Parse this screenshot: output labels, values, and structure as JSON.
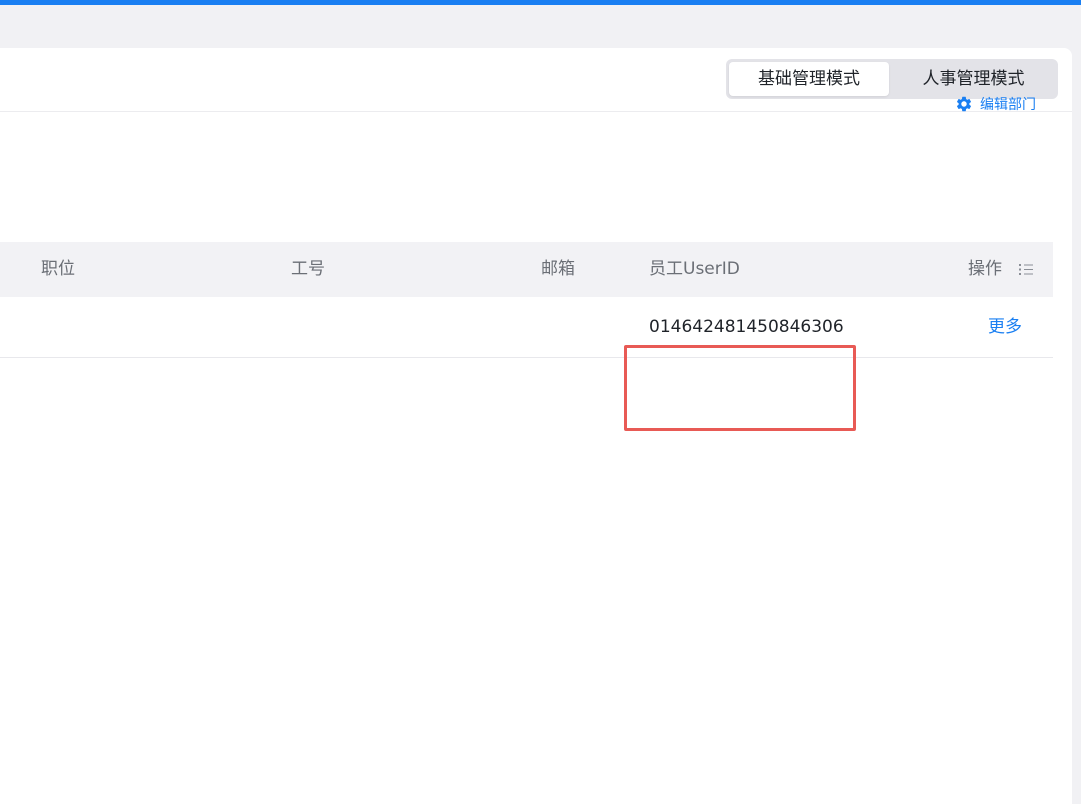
{
  "mode_switch": {
    "basic_label": "基础管理模式",
    "hr_label": "人事管理模式",
    "selected": "基础管理模式"
  },
  "department": {
    "edit_label": "编辑部门",
    "edit_icon": "gear-icon"
  },
  "table": {
    "headers": {
      "position": "职位",
      "employee_no": "工号",
      "email": "邮箱",
      "user_id": "员工UserID",
      "actions": "操作"
    },
    "rows": [
      {
        "position": "",
        "employee_no": "",
        "email": "",
        "user_id": "014642481450846306",
        "action_label": "更多"
      }
    ]
  },
  "colors": {
    "accent": "#1a7ff2",
    "highlight": "#e85a55"
  }
}
